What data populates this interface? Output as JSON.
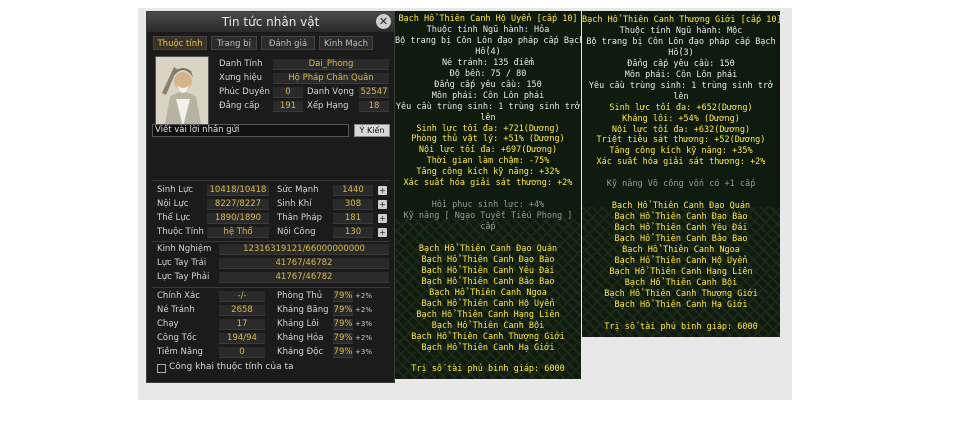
{
  "panel": {
    "title": "Tin tức nhân vật",
    "close": "✕",
    "tabs": [
      "Thuộc tính",
      "Trang bị",
      "Đánh giá",
      "Kinh Mạch"
    ],
    "profile": {
      "name_label": "Danh Tính",
      "name_value": "Dai_Phong",
      "title_label": "Xưng hiệu",
      "title_value": "Hộ Pháp Chân Quân",
      "fortune_label": "Phúc Duyên",
      "fortune_value": "0",
      "fame_label": "Danh Vọng",
      "fame_value": "52547",
      "level_label": "Đẳng cấp",
      "level_value": "191",
      "rank_label": "Xếp Hạng",
      "rank_value": "18"
    },
    "note_placeholder": "Viết vài lời nhắn gửi",
    "send_label": "Ý Kiến",
    "stats": {
      "hp_label": "Sinh Lực",
      "hp_value": "10418/10418",
      "str_label": "Sức Mạnh",
      "str_value": "1440",
      "mp_label": "Nội Lực",
      "mp_value": "8227/8227",
      "vit_label": "Sinh Khí",
      "vit_value": "308",
      "sta_label": "Thể Lực",
      "sta_value": "1890/1890",
      "agi_label": "Thân Pháp",
      "agi_value": "181",
      "elem_label": "Thuộc Tính",
      "elem_value": "hệ Thổ",
      "int_label": "Nội Công",
      "int_value": "130"
    },
    "exp": {
      "exp_label": "Kinh Nghiệm",
      "exp_value": "12316319121/66000000000",
      "left_label": "Lực Tay Trái",
      "left_value": "41767/46782",
      "right_label": "Lực Tay Phải",
      "right_value": "41767/46782"
    },
    "combat": {
      "acc_label": "Chính Xác",
      "acc_value": "-/-",
      "def_label": "Phòng Thủ",
      "def_value": "79%",
      "dod_label": "Né Tránh",
      "dod_value": "2658",
      "ice_label": "Kháng Băng",
      "ice_value": "79%",
      "run_label": "Chạy",
      "run_value": "17",
      "thu_label": "Kháng Lôi",
      "thu_value": "79%",
      "spd_label": "Công Tốc",
      "spd_value": "194/94",
      "fir_label": "Kháng Hỏa",
      "fir_value": "79%",
      "pot_label": "Tiềm Năng",
      "pot_value": "0",
      "poi_label": "Kháng Độc",
      "poi_value": "79%",
      "bonus": "+2%",
      "bonus3": "+3%"
    },
    "public_label": "Công khai thuộc tính của ta",
    "plus": "+"
  },
  "tip1": [
    {
      "t": "Bạch Hổ Thiên Canh Hộ Uyển [cấp 10]",
      "c": "y"
    },
    {
      "t": "Thuộc tính Ngũ hành: Hỏa",
      "c": "w"
    },
    {
      "t": "Bộ trang bị Côn Lôn đạo pháp cấp Bạch",
      "c": "w"
    },
    {
      "t": "Hổ(4)",
      "c": "w"
    },
    {
      "t": "Né tránh: 135 điểm",
      "c": "w"
    },
    {
      "t": "Độ bền: 75 / 80",
      "c": "w"
    },
    {
      "t": "Đẳng cấp yêu cầu: 150",
      "c": "w"
    },
    {
      "t": "Môn phái: Côn Lôn phái",
      "c": "w"
    },
    {
      "t": "Yêu cầu trùng sinh: 1 trùng sinh trở",
      "c": "w"
    },
    {
      "t": "lên",
      "c": "w"
    },
    {
      "t": "Sinh lực tối đa: +721(Dương)",
      "c": "y"
    },
    {
      "t": "Phòng thủ vật lý: +51% (Dương)",
      "c": "y"
    },
    {
      "t": "Nội lực tối đa: +697(Dương)",
      "c": "y"
    },
    {
      "t": "Thời gian làm chậm: -75%",
      "c": "y"
    },
    {
      "t": "Tăng công kích kỹ năng: +32%",
      "c": "y"
    },
    {
      "t": "Xác suất hóa giải sát thương: +2%",
      "c": "y"
    },
    {
      "t": "",
      "c": "w"
    },
    {
      "t": "Hồi phục sinh lực: +4%",
      "c": "g"
    },
    {
      "t": "Kỹ năng [ Ngạo Tuyết Tiếu Phong ]",
      "c": "g"
    },
    {
      "t": "cấp",
      "c": "g"
    },
    {
      "t": "",
      "c": "w"
    },
    {
      "t": "Bạch Hổ Thiên Canh Đạo Quán",
      "c": "y"
    },
    {
      "t": "Bạch Hổ Thiên Canh Đạo Bào",
      "c": "y"
    },
    {
      "t": "Bạch Hổ Thiên Canh Yêu Đái",
      "c": "y"
    },
    {
      "t": "Bạch Hổ Thiên Canh Bảo Bao",
      "c": "y"
    },
    {
      "t": "Bạch Hổ Thiên Canh Ngoa",
      "c": "y"
    },
    {
      "t": "Bạch Hổ Thiên Canh Hộ Uyển",
      "c": "y"
    },
    {
      "t": "Bạch Hổ Thiên Canh Hạng Liên",
      "c": "y"
    },
    {
      "t": "Bạch Hổ Thiên Canh Bội",
      "c": "y"
    },
    {
      "t": "Bạch Hổ Thiên Canh Thượng Giới",
      "c": "y"
    },
    {
      "t": "Bạch Hổ Thiên Canh Hạ Giới",
      "c": "y"
    },
    {
      "t": "",
      "c": "w"
    },
    {
      "t": "Trị số tài phú binh giáp: 6000",
      "c": "y"
    }
  ],
  "tip2": [
    {
      "t": "Bạch Hổ Thiên Canh Thượng Giới [cấp 10]",
      "c": "y"
    },
    {
      "t": "Thuộc tính Ngũ hành: Mộc",
      "c": "w"
    },
    {
      "t": "Bộ trang bị Côn Lôn đạo pháp cấp Bạch",
      "c": "w"
    },
    {
      "t": "Hổ(3)",
      "c": "w"
    },
    {
      "t": "Đẳng cấp yêu cầu: 150",
      "c": "w"
    },
    {
      "t": "Môn phái: Côn Lôn phái",
      "c": "w"
    },
    {
      "t": "Yêu cầu trùng sinh: 1 trùng sinh trở",
      "c": "w"
    },
    {
      "t": "lên",
      "c": "w"
    },
    {
      "t": "Sinh lực tối đa: +652(Dương)",
      "c": "y"
    },
    {
      "t": "Kháng lôi: +54% (Dương)",
      "c": "y"
    },
    {
      "t": "Nội lực tối đa: +632(Dương)",
      "c": "y"
    },
    {
      "t": "Triệt tiêu sát thương: +52(Dương)",
      "c": "y"
    },
    {
      "t": "Tăng công kích kỹ năng: +35%",
      "c": "y"
    },
    {
      "t": "Xác suất hóa giải sát thương: +2%",
      "c": "y"
    },
    {
      "t": "",
      "c": "w"
    },
    {
      "t": "Kỹ năng Võ công vốn có +1 cấp",
      "c": "g"
    },
    {
      "t": "",
      "c": "w"
    },
    {
      "t": "Bạch Hổ Thiên Canh Đạo Quán",
      "c": "y"
    },
    {
      "t": "Bạch Hổ Thiên Canh Đạo Bào",
      "c": "y"
    },
    {
      "t": "Bạch Hổ Thiên Canh Yêu Đái",
      "c": "y"
    },
    {
      "t": "Bạch Hổ Thiên Canh Bảo Bao",
      "c": "y"
    },
    {
      "t": "Bạch Hổ Thiên Canh Ngoa",
      "c": "y"
    },
    {
      "t": "Bạch Hổ Thiên Canh Hộ Uyển",
      "c": "y"
    },
    {
      "t": "Bạch Hổ Thiên Canh Hạng Liên",
      "c": "y"
    },
    {
      "t": "Bạch Hổ Thiên Canh Bội",
      "c": "y"
    },
    {
      "t": "Bạch Hổ Thiên Canh Thượng Giới",
      "c": "y"
    },
    {
      "t": "Bạch Hổ Thiên Canh Hạ Giới",
      "c": "y"
    },
    {
      "t": "",
      "c": "w"
    },
    {
      "t": "Trị số tài phú binh giáp: 6000",
      "c": "y"
    }
  ]
}
